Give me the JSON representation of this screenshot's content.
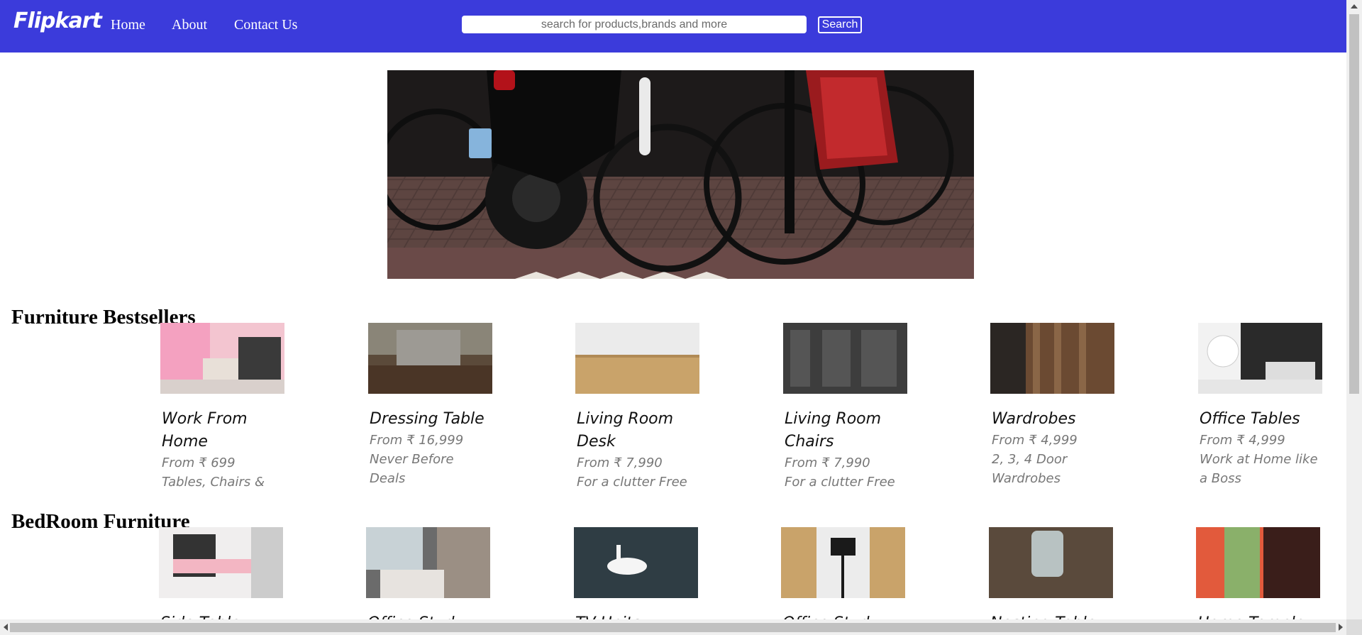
{
  "navbar": {
    "logo": "Flipkart",
    "links": [
      "Home",
      "About",
      "Contact Us"
    ],
    "search_placeholder": "search for products,brands and more",
    "search_button": "Search",
    "background": "#3b3bdb"
  },
  "hero": {
    "image": "bicycles-parked-photo"
  },
  "sections": [
    {
      "title": "Furniture Bestsellers",
      "cards": [
        {
          "title": "Work From Home",
          "price": "From ₹ 699",
          "desc": "Tables, Chairs & More"
        },
        {
          "title": "Dressing Table",
          "price": "From ₹ 16,999",
          "desc": "Never Before Deals"
        },
        {
          "title": "Living Room Desk",
          "price": "From ₹ 7,990",
          "desc": "For a clutter Free workstation"
        },
        {
          "title": "Living Room Chairs",
          "price": "From ₹ 7,990",
          "desc": "For a clutter Free workstation"
        },
        {
          "title": "Wardrobes",
          "price": "From ₹ 4,999",
          "desc": "2, 3, 4 Door Wardrobes"
        },
        {
          "title": "Office Tables",
          "price": "From ₹ 4,999",
          "desc": "Work at Home like a Boss"
        }
      ]
    },
    {
      "title": "BedRoom Furniture",
      "cards": [
        {
          "title": "Side Table"
        },
        {
          "title": "Office Study"
        },
        {
          "title": "TV Units"
        },
        {
          "title": "Office Study"
        },
        {
          "title": "Nesting Table"
        },
        {
          "title": "Home Temple"
        }
      ]
    }
  ]
}
